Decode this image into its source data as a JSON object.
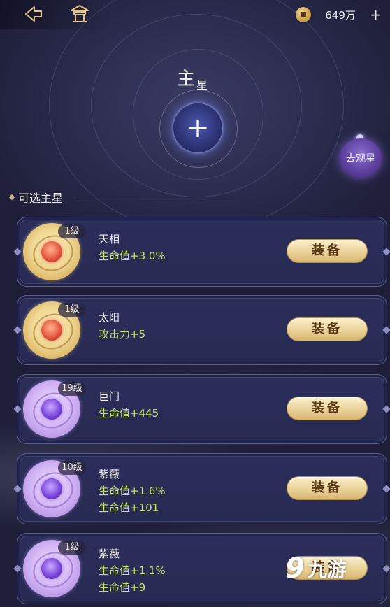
{
  "topbar": {
    "back_icon": "back-arrow-icon",
    "home_icon": "pavilion-icon",
    "currency": {
      "icon": "copper-coin-icon",
      "amount": "649万",
      "add_label": "+"
    }
  },
  "main_star": {
    "title_big": "主",
    "title_small": "星",
    "slot_label": "+",
    "observe_label": "去观星"
  },
  "section": {
    "title": "可选主星"
  },
  "cards": [
    {
      "level": "1级",
      "name": "天相",
      "stats": [
        "生命值+3.0%"
      ],
      "equip_label": "装备",
      "rarity": "gold"
    },
    {
      "level": "1级",
      "name": "太阳",
      "stats": [
        "攻击力+5"
      ],
      "equip_label": "装备",
      "rarity": "gold"
    },
    {
      "level": "19级",
      "name": "巨门",
      "stats": [
        "生命值+445"
      ],
      "equip_label": "装备",
      "rarity": "purple"
    },
    {
      "level": "10级",
      "name": "紫薇",
      "stats": [
        "生命值+1.6%",
        "生命值+101"
      ],
      "equip_label": "装备",
      "rarity": "purple"
    },
    {
      "level": "1级",
      "name": "紫薇",
      "stats": [
        "生命值+1.1%",
        "生命值+9"
      ],
      "equip_label": "装备",
      "rarity": "purple"
    }
  ],
  "watermark": {
    "mark": "9",
    "text": "九游"
  },
  "colors": {
    "stat_green": "#c2e36a",
    "equip_gold": "#ecd59c",
    "background": "#23233f"
  }
}
